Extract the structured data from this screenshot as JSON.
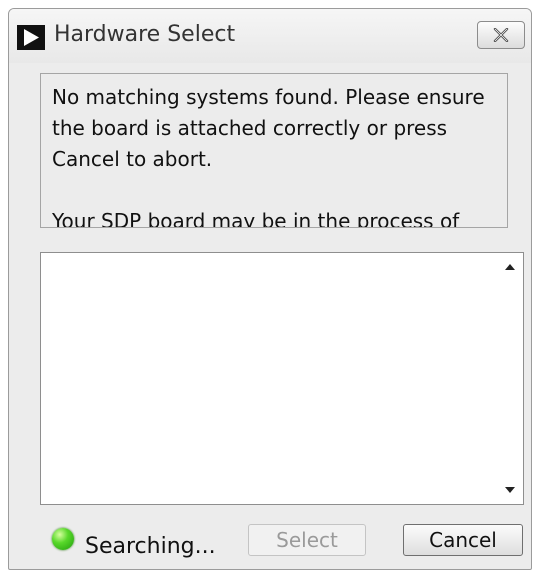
{
  "window": {
    "title": "Hardware Select",
    "close_icon": "close-x-icon",
    "app_icon": "play-triangle-icon"
  },
  "message": {
    "text": "No matching systems found. Please ensure the board is attached correctly or press Cancel to abort.\n\nYour SDP board may be in the process of"
  },
  "list": {
    "items": [],
    "scroll_up_icon": "scroll-up-arrow-icon",
    "scroll_down_icon": "scroll-down-arrow-icon"
  },
  "status": {
    "text": "Searching...",
    "indicator_color": "#3cc81a"
  },
  "buttons": {
    "select_label": "Select",
    "select_enabled": false,
    "cancel_label": "Cancel"
  }
}
